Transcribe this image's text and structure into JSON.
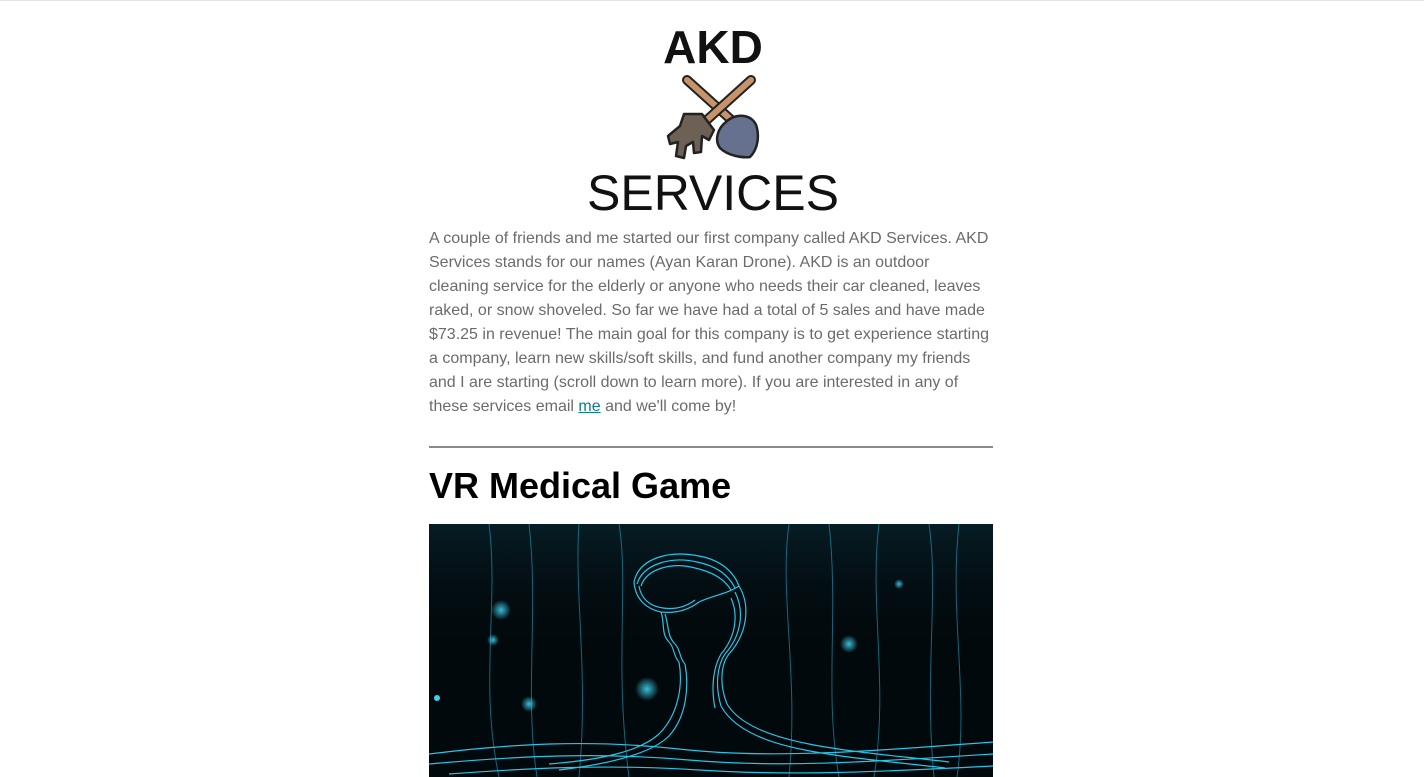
{
  "logo": {
    "top_text": "AKD",
    "bottom_text": "SERVICES",
    "icon": "crossed-rake-shovel-icon"
  },
  "intro": {
    "text_before_link": "A couple of friends and me started our first company called AKD Services. AKD Services stands for our names (Ayan Karan Drone). AKD is an outdoor cleaning service for the elderly or anyone who needs their car cleaned, leaves raked, or snow shoveled. So far we have had a total of 5 sales and have made $73.25 in revenue!  The main goal for this company is to get experience starting a company, learn new skills/soft skills, and fund another company my friends and I are starting (scroll down to learn more). If you are interested in any of these services email ",
    "link_text": "me",
    "text_after_link": " and we'll come by!"
  },
  "vr_section": {
    "title": "VR Medical Game",
    "image": "vr-headset-wireframe-image"
  },
  "colors": {
    "body_text": "#6b6b6b",
    "link": "#0a7e8c",
    "divider": "#8a8a8a",
    "hero_bg": "#02090c",
    "hero_lines": "#1fb6d6"
  }
}
